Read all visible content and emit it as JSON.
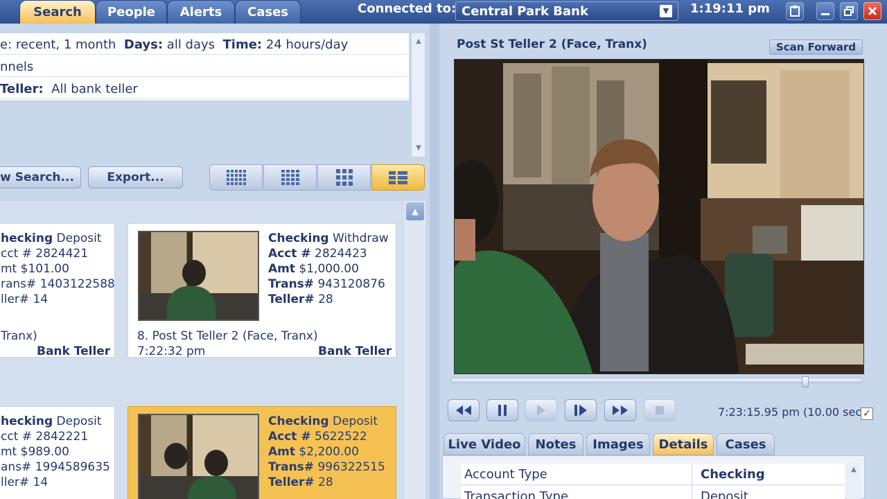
{
  "tabs": [
    {
      "label": "Search"
    },
    {
      "label": "People"
    },
    {
      "label": "Alerts"
    },
    {
      "label": "Cases"
    }
  ],
  "header": {
    "connected_label": "Connected to:",
    "bank": "Central Park Bank",
    "clock": "1:19:11 pm"
  },
  "criteria": {
    "row1_a": "e: recent, 1 month",
    "row1_b_label": "Days:",
    "row1_b_value": "all days",
    "row1_c_label": "Time:",
    "row1_c_value": "24 hours/day",
    "row2": "nnels",
    "row3_label": "Teller:",
    "row3_value": "All bank teller"
  },
  "toolbar": {
    "new_search": "w Search...",
    "export": "Export..."
  },
  "results": [
    {
      "type": "hecking",
      "kind": "Deposit",
      "acct_label": "cct #",
      "acct": "2824421",
      "amt_label": "mt",
      "amt": "$101.00",
      "trans_label": "rans#",
      "trans": "1403122588",
      "teller_label": "ller#",
      "teller": "14",
      "caption": " Tranx)",
      "time": "",
      "role": "Bank Teller"
    },
    {
      "type": "Checking",
      "kind": "Withdraw",
      "acct_label": "Acct #",
      "acct": "2824423",
      "amt_label": "Amt",
      "amt": "$1,000.00",
      "trans_label": "Trans#",
      "trans": "943120876",
      "teller_label": "Teller#",
      "teller": "28",
      "caption": "8. Post St Teller 2 (Face, Tranx)",
      "time": "7:22:32 pm",
      "role": "Bank Teller"
    },
    {
      "type": "hecking",
      "kind": "Deposit",
      "acct_label": "cct #",
      "acct": "2842221",
      "amt_label": "mt",
      "amt": "$989.00",
      "trans_label": "ans#",
      "trans": "1994589635",
      "teller_label": "ller#",
      "teller": "14"
    },
    {
      "type": "Checking",
      "kind": "Deposit",
      "acct_label": "Acct #",
      "acct": "5622522",
      "amt_label": "Amt",
      "amt": "$2,200.00",
      "trans_label": "Trans#",
      "trans": "996322515",
      "teller_label": "Teller#",
      "teller": "28"
    }
  ],
  "video": {
    "title": "Post St Teller 2 (Face, Tranx)",
    "scan_forward": "Scan Forward",
    "playback_position": 0.86,
    "timestamp": "7:23:15.95 pm (10.00 sec)",
    "timestamp_checked": true
  },
  "detail_tabs": [
    {
      "label": "Live Video"
    },
    {
      "label": "Notes"
    },
    {
      "label": "Images"
    },
    {
      "label": "Details"
    },
    {
      "label": "Cases"
    }
  ],
  "details": [
    {
      "label": "Account Type",
      "value": "Checking"
    },
    {
      "label": "Transaction Type",
      "value": "Deposit"
    }
  ],
  "icons": {
    "window_minimize": "minimize-icon",
    "window_restore": "restore-icon",
    "window_close": "close-icon",
    "sticky": "note-icon"
  },
  "colors": {
    "accent": "#f6c15a",
    "titlebar": "#2f4f8f",
    "close": "#c22c1b"
  }
}
